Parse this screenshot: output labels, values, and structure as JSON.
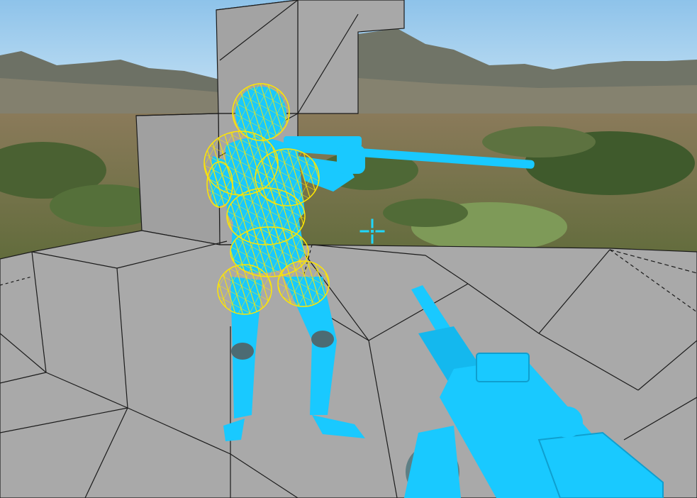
{
  "scene": {
    "title": "",
    "sky_top": "#8ec3ea",
    "sky_bottom": "#cfe6f6",
    "mountain_color": "#6f7469",
    "vegetation_color": "#4f6a36",
    "block_fill": "#a9a9a9",
    "block_lines": "#1b1b1b",
    "character_color": "#19c9ff",
    "character_shade": "#4c6b73",
    "hitbox_color": "#ffe600",
    "crosshair_color": "#1fd7ff"
  },
  "hud": {
    "crosshair_icon": "crosshair-icon"
  }
}
